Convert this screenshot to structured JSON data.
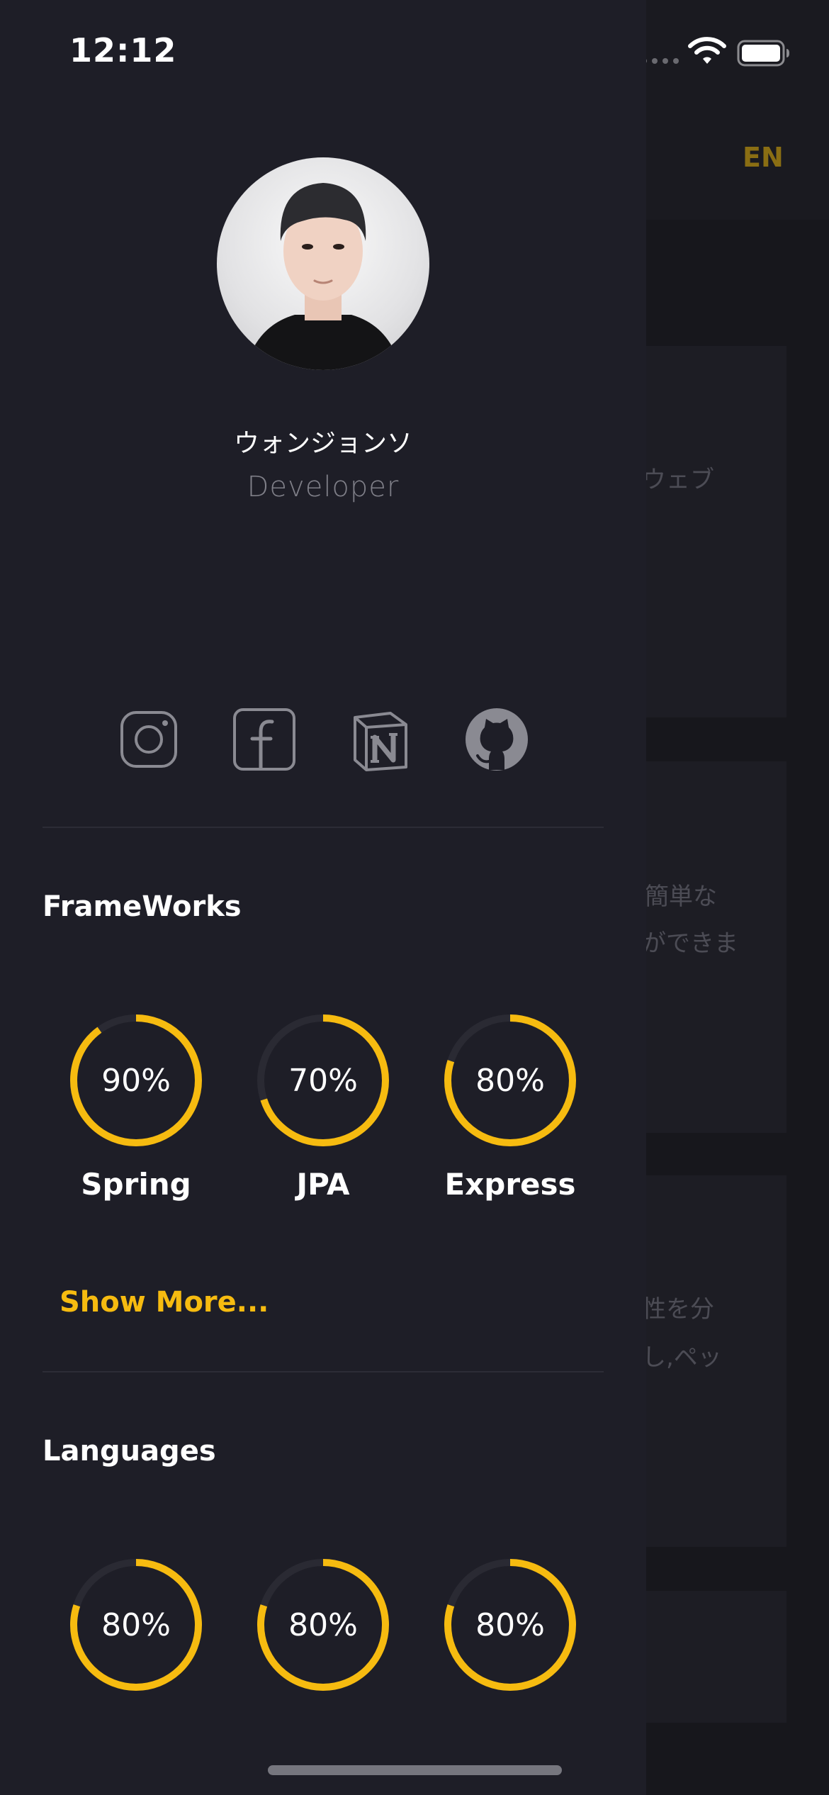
{
  "status_bar": {
    "time": "12:12"
  },
  "background": {
    "language_button": "EN",
    "card_texts": [
      "ウェブ",
      "簡単な",
      "ができま",
      "性を分",
      "し,ペッ"
    ]
  },
  "profile": {
    "name": "ウォンジョンソ",
    "role": "Developer"
  },
  "social_links": [
    {
      "name": "instagram",
      "icon": "instagram-icon"
    },
    {
      "name": "facebook",
      "icon": "facebook-icon"
    },
    {
      "name": "notion",
      "icon": "notion-icon"
    },
    {
      "name": "github",
      "icon": "github-icon"
    }
  ],
  "frameworks": {
    "title": "FrameWorks",
    "items": [
      {
        "label": "Spring",
        "percent_text": "90%",
        "value": 90
      },
      {
        "label": "JPA",
        "percent_text": "70%",
        "value": 70
      },
      {
        "label": "Express",
        "percent_text": "80%",
        "value": 80
      }
    ],
    "show_more": "Show More..."
  },
  "languages": {
    "title": "Languages",
    "items": [
      {
        "percent_text": "80%",
        "value": 80
      },
      {
        "percent_text": "80%",
        "value": 80
      },
      {
        "percent_text": "80%",
        "value": 80
      }
    ]
  },
  "colors": {
    "accent": "#f6bb10",
    "drawer_bg": "#1e1e27",
    "ring_track": "#2a2a33"
  }
}
